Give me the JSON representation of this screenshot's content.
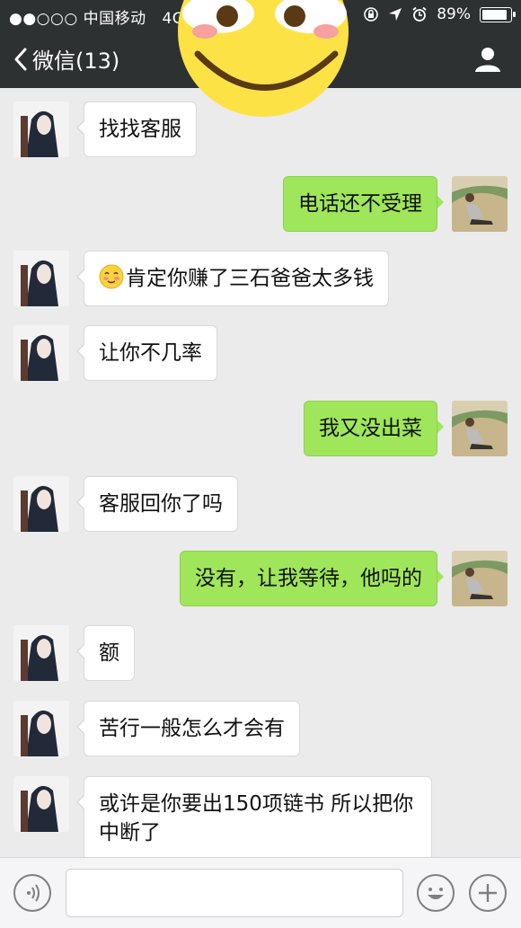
{
  "status_bar": {
    "carrier": "●●○○○ 中国移动",
    "network": "4G",
    "battery": "89%"
  },
  "nav": {
    "back_label": "微信(13)"
  },
  "messages": [
    {
      "side": "in",
      "text": "找找客服"
    },
    {
      "side": "out",
      "text": "电话还不受理"
    },
    {
      "side": "in",
      "text": "肯定你赚了三石爸爸太多钱",
      "emoji": "blushing-face"
    },
    {
      "side": "in",
      "text": "让你不几率"
    },
    {
      "side": "out",
      "text": "我又没出菜"
    },
    {
      "side": "in",
      "text": "客服回你了吗"
    },
    {
      "side": "out",
      "text": "没有，让我等待，他吗的"
    },
    {
      "side": "in",
      "text": "额"
    },
    {
      "side": "in",
      "text": "苦行一般怎么才会有"
    },
    {
      "side": "in",
      "text": "或许是你要出150项链书  所以把你中断了"
    }
  ],
  "colors": {
    "bar": "#2e3132",
    "chat_bg": "#ebebeb",
    "out_bubble": "#9fe65a",
    "in_bubble": "#ffffff"
  }
}
